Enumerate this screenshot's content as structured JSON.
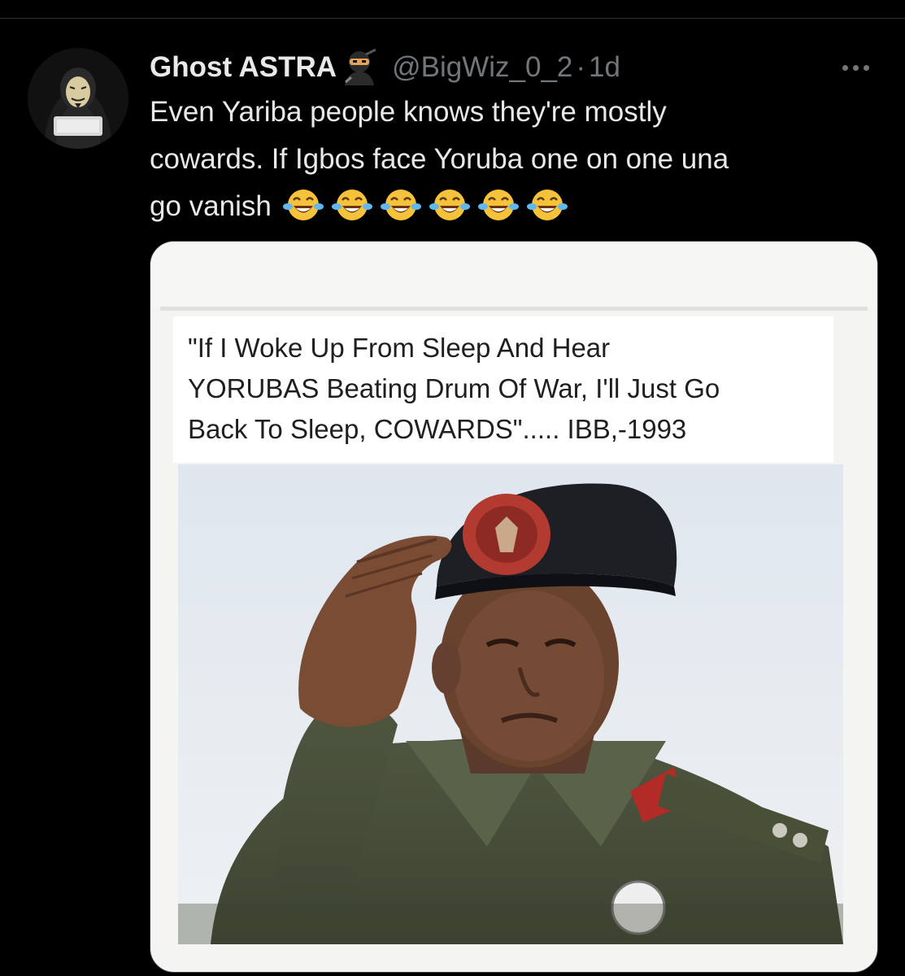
{
  "post": {
    "author_name": "Ghost ASTRA",
    "author_emoji_icon": "ninja-icon",
    "handle": "@BigWiz_0_2",
    "separator": "·",
    "time": "1d",
    "more_icon": "more-horizontal-icon",
    "text": "Even Yariba people knows they're mostly\ncowards. If Igbos face Yoruba one on one una\ngo vanish",
    "text_emoji_icon": "face-with-tears-of-joy-icon",
    "text_emoji_count": 6
  },
  "media": {
    "quote": "\"If I Woke Up From Sleep And Hear\nYORUBAS Beating Drum Of War, I'll Just Go\nBack To Sleep, COWARDS\"..... IBB,-1993",
    "photo_subject": "man in military uniform and beret saluting"
  },
  "colors": {
    "background": "#000000",
    "primary_text": "#e7e9ea",
    "secondary_text": "#71767b",
    "border": "#2f3336"
  }
}
